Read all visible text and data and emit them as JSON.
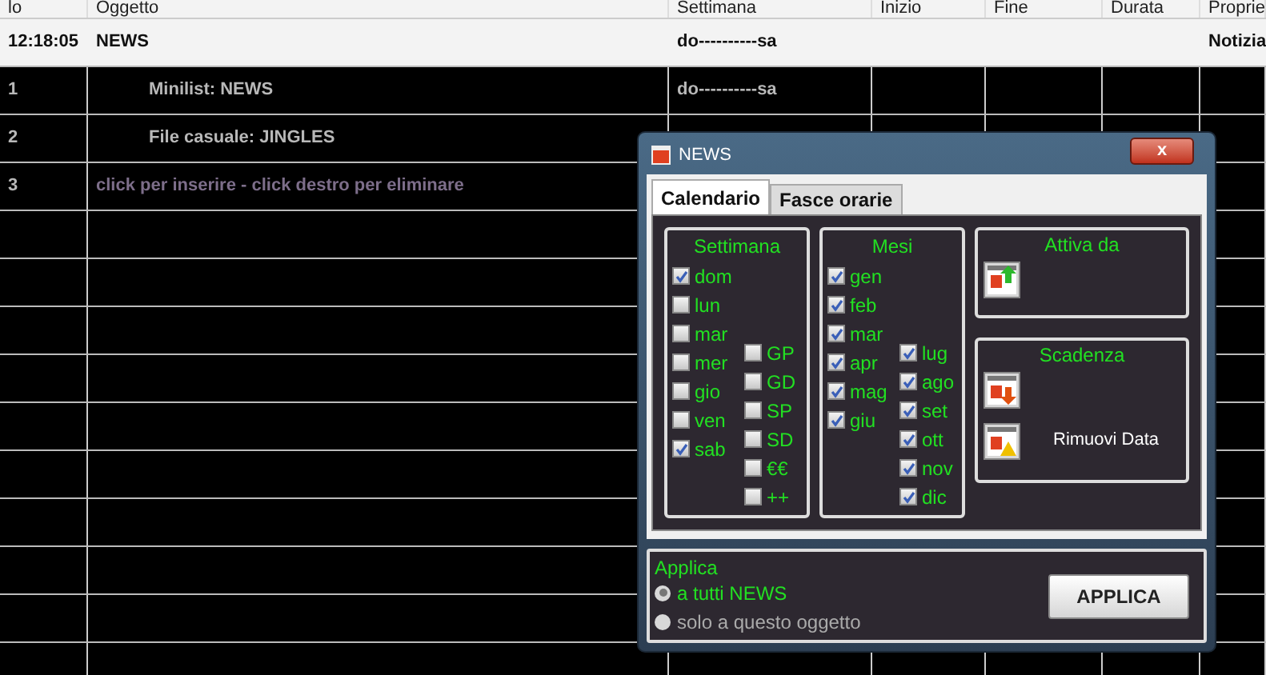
{
  "table": {
    "columns": [
      "lo",
      "Oggetto",
      "Settimana",
      "Inizio",
      "Fine",
      "Durata",
      "Proprie"
    ],
    "rows": [
      {
        "kind": "header",
        "cells": [
          "12:18:05",
          "NEWS",
          "do----------sa",
          "",
          "",
          "",
          "Notizia"
        ]
      },
      {
        "kind": "item",
        "cells": [
          "1",
          "Minilist: NEWS",
          "do----------sa",
          "",
          "",
          "",
          ""
        ]
      },
      {
        "kind": "item",
        "cells": [
          "2",
          "File casuale: JINGLES",
          "",
          "",
          "",
          "",
          ""
        ]
      },
      {
        "kind": "hint",
        "cells": [
          "3",
          "click per inserire - click destro per eliminare",
          "",
          "",
          "",
          "",
          ""
        ]
      }
    ]
  },
  "dialog": {
    "title": "NEWS",
    "close": "x",
    "tabs": [
      {
        "label": "Calendario",
        "selected": true
      },
      {
        "label": "Fasce orarie",
        "selected": false
      }
    ],
    "settimana": {
      "title": "Settimana",
      "left": [
        {
          "label": "dom",
          "checked": true
        },
        {
          "label": "lun",
          "checked": false
        },
        {
          "label": "mar",
          "checked": false
        },
        {
          "label": "mer",
          "checked": false
        },
        {
          "label": "gio",
          "checked": false
        },
        {
          "label": "ven",
          "checked": false
        },
        {
          "label": "sab",
          "checked": true
        }
      ],
      "right": [
        {
          "label": "GP",
          "checked": false
        },
        {
          "label": "GD",
          "checked": false
        },
        {
          "label": "SP",
          "checked": false
        },
        {
          "label": "SD",
          "checked": false
        },
        {
          "label": "€€",
          "checked": false
        },
        {
          "label": "++",
          "checked": false
        }
      ]
    },
    "mesi": {
      "title": "Mesi",
      "left": [
        {
          "label": "gen",
          "checked": true
        },
        {
          "label": "feb",
          "checked": true
        },
        {
          "label": "mar",
          "checked": true
        },
        {
          "label": "apr",
          "checked": true
        },
        {
          "label": "mag",
          "checked": true
        },
        {
          "label": "giu",
          "checked": true
        }
      ],
      "right": [
        {
          "label": "lug",
          "checked": true
        },
        {
          "label": "ago",
          "checked": true
        },
        {
          "label": "set",
          "checked": true
        },
        {
          "label": "ott",
          "checked": true
        },
        {
          "label": "nov",
          "checked": true
        },
        {
          "label": "dic",
          "checked": true
        }
      ]
    },
    "attiva_da": {
      "title": "Attiva da"
    },
    "scadenza": {
      "title": "Scadenza",
      "remove": "Rimuovi Data"
    },
    "applica": {
      "title": "Applica",
      "options": [
        {
          "label": "a tutti NEWS",
          "selected": true
        },
        {
          "label": "solo a questo oggetto",
          "selected": false
        }
      ],
      "button": "APPLICA"
    }
  }
}
